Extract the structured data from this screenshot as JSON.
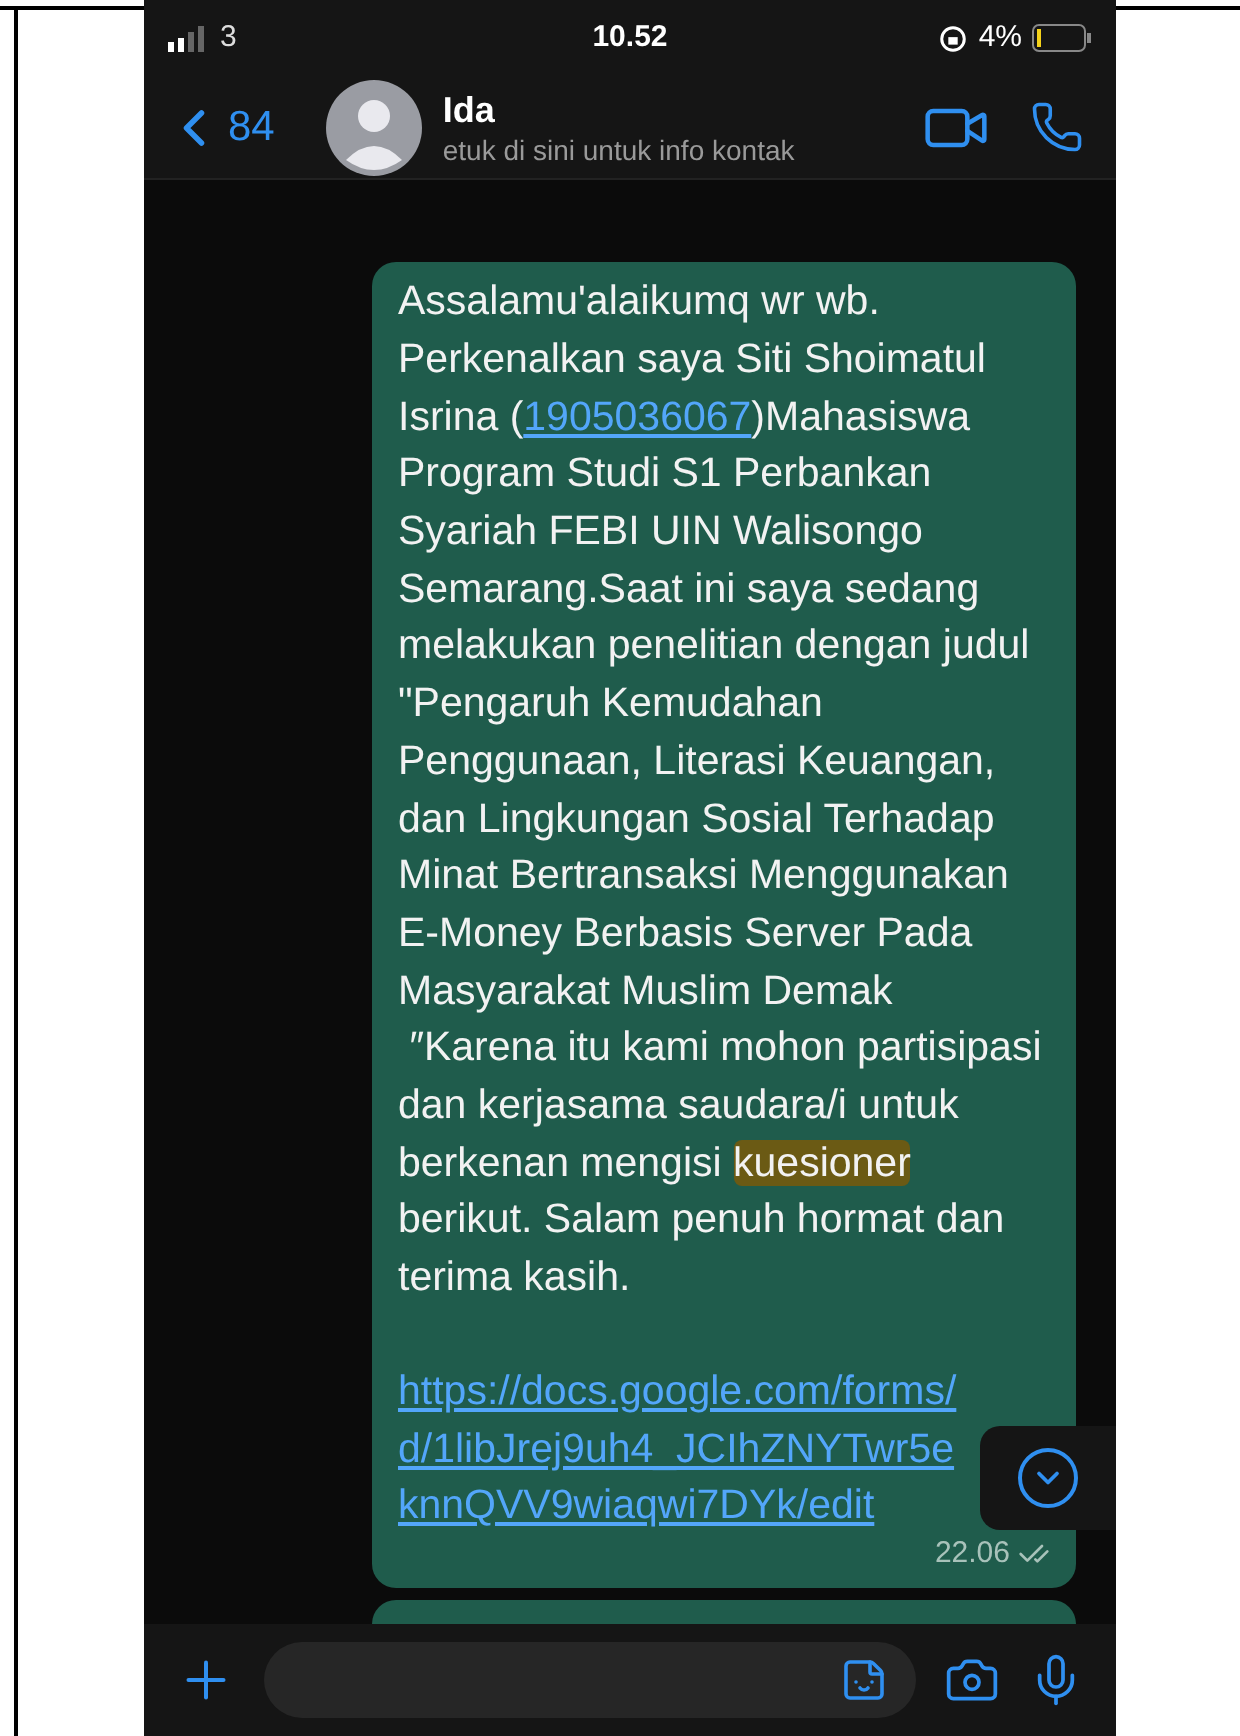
{
  "status_bar": {
    "carrier": "3",
    "time": "10.52",
    "battery": "4%"
  },
  "header": {
    "back_count": "84",
    "name": "Ida",
    "subtitle": "etuk di sini untuk info kontak"
  },
  "message": {
    "paragraphs": [
      [
        {
          "kind": "text",
          "text": "Assalamu'alaikumq wr wb. Perkenalkan saya Siti Shoimatul Isrina ("
        },
        {
          "kind": "link",
          "text": "1905036067"
        },
        {
          "kind": "text",
          "text": ")Mahasiswa Program Studi S1 Perbankan Syariah FEBI UIN Walisongo Semarang.Saat ini saya sedang melakukan penelitian dengan judul \"Pengaruh Kemudahan Penggunaan, Literasi Keuangan, dan Lingkungan Sosial Terhadap Minat Bertransaksi Menggunakan E-Money Berbasis Server Pada Masyarakat Muslim Demak  ″Karena itu kami mohon partisipasi dan kerjasama saudara/i untuk berkenan mengisi "
        },
        {
          "kind": "highlight",
          "text": "kuesioner"
        },
        {
          "kind": "text",
          "text": " berikut. Salam penuh hormat dan terima kasih."
        }
      ],
      [
        {
          "kind": "link",
          "text": "https://docs.google.com/forms/d/1libJrej9uh4_JCIhZNYTwr5eknnQVV9wiaqwi7DYk/edit"
        }
      ]
    ],
    "time": "22.06"
  }
}
